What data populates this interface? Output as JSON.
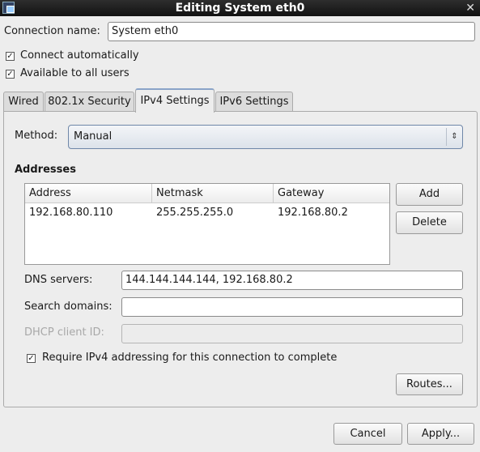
{
  "window": {
    "title": "Editing System eth0",
    "icon": "network-window-icon",
    "close_icon": "close-icon"
  },
  "connection_name": {
    "label": "Connection name:",
    "value": "System eth0"
  },
  "checkboxes": {
    "connect_auto": {
      "label": "Connect automatically",
      "checked": true
    },
    "all_users": {
      "label": "Available to all users",
      "checked": true
    }
  },
  "tabs": [
    {
      "label": "Wired"
    },
    {
      "label": "802.1x Security"
    },
    {
      "label": "IPv4 Settings",
      "active": true
    },
    {
      "label": "IPv6 Settings"
    }
  ],
  "ipv4": {
    "method_label": "Method:",
    "method_value": "Manual",
    "addresses_heading": "Addresses",
    "columns": [
      "Address",
      "Netmask",
      "Gateway"
    ],
    "rows": [
      [
        "192.168.80.110",
        "255.255.255.0",
        "192.168.80.2"
      ]
    ],
    "add_label": "Add",
    "delete_label": "Delete",
    "dns_label": "DNS servers:",
    "dns_value": "144.144.144.144, 192.168.80.2",
    "search_label": "Search domains:",
    "search_value": "",
    "dhcp_label": "DHCP client ID:",
    "dhcp_value": "",
    "require_label": "Require IPv4 addressing for this connection to complete",
    "require_checked": true,
    "routes_label": "Routes..."
  },
  "footer": {
    "cancel_label": "Cancel",
    "apply_label": "Apply..."
  },
  "colors": {
    "titlebar": "#1e1e1e",
    "active_tab_accent": "#8aa4c8"
  }
}
